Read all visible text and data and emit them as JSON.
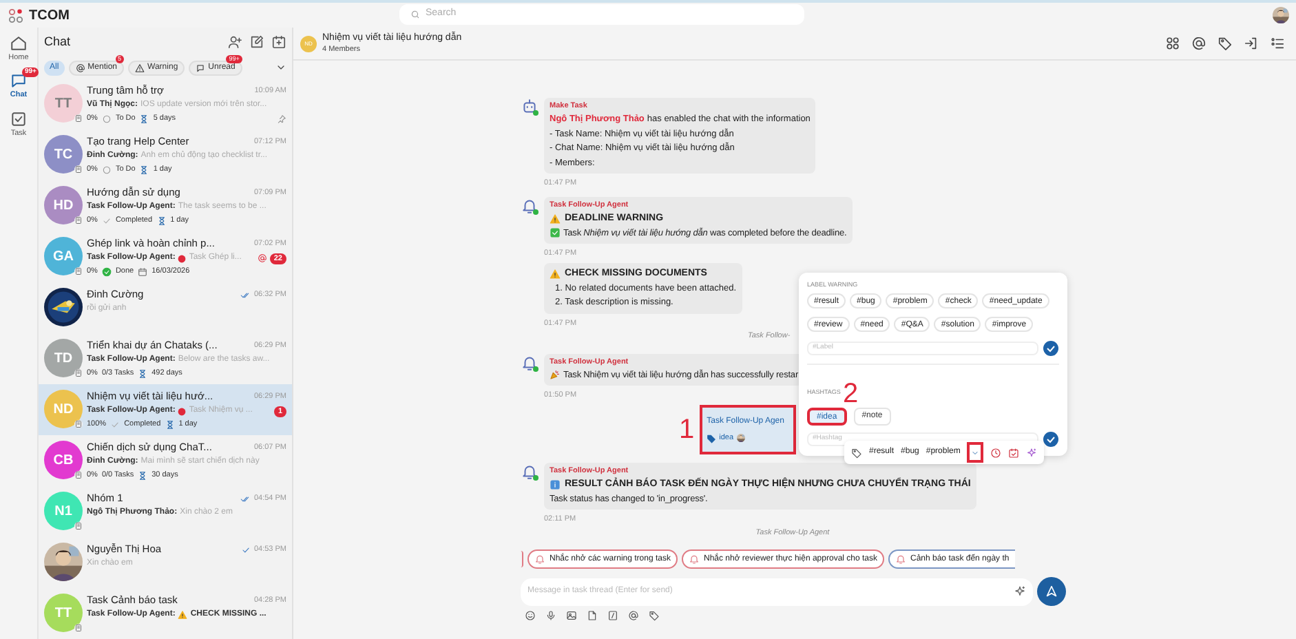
{
  "top_bar": {
    "app_name": "TCOM",
    "search_placeholder": "Search"
  },
  "nav": [
    {
      "label": "Home",
      "selected": false
    },
    {
      "label": "Chat",
      "selected": true,
      "badge": "99+"
    },
    {
      "label": "Task",
      "selected": false
    }
  ],
  "chat_list": {
    "title": "Chat",
    "filters": [
      {
        "label": "All",
        "selected": true
      },
      {
        "label": "Mention",
        "selected": false,
        "badge": "5"
      },
      {
        "label": "Warning",
        "selected": false
      },
      {
        "label": "Unread",
        "selected": false,
        "badge": "99+"
      }
    ],
    "conversations": [
      {
        "avatar": {
          "kind": "initials",
          "initials": "TT",
          "color": "#f3cfd6"
        },
        "name": "Trung tâm hỗ trợ",
        "time": "10:09 AM",
        "sender": "Vũ Thị Ngọc:",
        "preview": "IOS update version mới trên stor...",
        "progress": "0%",
        "status": {
          "kind": "todo",
          "text": "To Do"
        },
        "due": {
          "kind": "duration",
          "text": "5 days"
        },
        "pinned": true,
        "selected": false
      },
      {
        "avatar": {
          "kind": "initials",
          "initials": "TC",
          "color": "#8d8fc6"
        },
        "name": "Tạo trang Help Center",
        "time": "07:12 PM",
        "sender": "Đinh Cường:",
        "preview": "Anh em chủ động tạo checklist tr...",
        "progress": "0%",
        "status": {
          "kind": "todo",
          "text": "To Do"
        },
        "due": {
          "kind": "duration",
          "text": "1 day"
        },
        "selected": false
      },
      {
        "avatar": {
          "kind": "initials",
          "initials": "HD",
          "color": "#aa8cc2"
        },
        "name": "Hướng dẫn sử dụng",
        "time": "07:09 PM",
        "sender": "Task Follow-Up Agent:",
        "preview": "The task seems to be ...",
        "progress": "0%",
        "status": {
          "kind": "completed",
          "text": "Completed"
        },
        "due": {
          "kind": "duration",
          "text": "1 day"
        },
        "selected": false
      },
      {
        "avatar": {
          "kind": "initials",
          "initials": "GA",
          "color": "#4fb4d8"
        },
        "name": "Ghép link và hoàn chỉnh p...",
        "time": "07:02 PM",
        "sender": "Task Follow-Up Agent:",
        "alert": true,
        "preview": "Task Ghép li...",
        "mention": true,
        "unread": "22",
        "progress": "0%",
        "status": {
          "kind": "done",
          "text": "Done"
        },
        "due": {
          "kind": "date",
          "text": "16/03/2026"
        },
        "selected": false
      },
      {
        "name": "Đinh Cường",
        "time": "06:32 PM",
        "receipt": {
          "kind": "double"
        },
        "preview": "rồi gửi anh",
        "selected": false
      },
      {
        "avatar": {
          "kind": "initials",
          "initials": "TD",
          "color": "#a3a7a6"
        },
        "name": "Triển khai dự án Chataks (...",
        "time": "06:29 PM",
        "sender": "Task Follow-Up Agent:",
        "preview": "Below are the tasks aw...",
        "progress": "0%",
        "status": {
          "kind": "tasks",
          "text": "0/3 Tasks"
        },
        "due": {
          "kind": "duration",
          "text": "492 days"
        },
        "selected": false
      },
      {
        "avatar": {
          "kind": "initials",
          "initials": "ND",
          "color": "#ecc24e"
        },
        "name": "Nhiệm vụ viết tài liệu hướ...",
        "time": "06:29 PM",
        "sender": "Task Follow-Up Agent:",
        "alert": true,
        "preview": "Task Nhiệm vụ ...",
        "unread": "1",
        "progress": "100%",
        "status": {
          "kind": "completed",
          "text": "Completed"
        },
        "due": {
          "kind": "duration",
          "text": "1 day"
        },
        "selected": true
      },
      {
        "avatar": {
          "kind": "initials",
          "initials": "CB",
          "color": "#e23ad0"
        },
        "name": "Chiến dịch sử dụng ChaT...",
        "time": "06:07 PM",
        "sender": "Đinh Cường:",
        "preview": "Mai mình sẽ start chiến dịch này",
        "progress": "0%",
        "status": {
          "kind": "tasks",
          "text": "0/0 Tasks"
        },
        "due": {
          "kind": "duration",
          "text": "30 days"
        },
        "selected": false
      },
      {
        "avatar": {
          "kind": "initials",
          "initials": "N1",
          "color": "#3fe6b3"
        },
        "name": "Nhóm 1",
        "time": "04:54 PM",
        "receipt": {
          "kind": "double"
        },
        "sender": "Ngô Thị Phương Thảo:",
        "preview": "Xin chào 2 em",
        "selected": false
      },
      {
        "name": "Nguyễn Thị Hoa",
        "time": "04:53 PM",
        "receipt": {
          "kind": "single"
        },
        "preview": "Xin chào em",
        "selected": false
      },
      {
        "avatar": {
          "kind": "initials",
          "initials": "TT",
          "color": "#a6dc5c"
        },
        "name": "Task Cảnh báo task",
        "time": "04:28 PM",
        "sender": "Task Follow-Up Agent:",
        "preview_warning": true,
        "preview": "CHECK MISSING ...",
        "preview_bold": true,
        "selected": false
      }
    ]
  },
  "conversation": {
    "initials": "ND",
    "color": "#ecc24e",
    "title": "Nhiệm vụ viết tài liệu hướng dẫn",
    "subtitle": "4 Members"
  },
  "messages": [
    {
      "kind": "system",
      "sender": "Make Task",
      "actor": "Ngô Thị Phương Thảo",
      "text": "has enabled the chat with the information",
      "lines": [
        "- Task Name: Nhiệm vụ viết tài liệu hướng dẫn",
        "- Chat Name: Nhiệm vụ viết tài liệu hướng dẫn",
        "- Members:"
      ],
      "time": "01:47 PM"
    },
    {
      "kind": "agent",
      "sender": "Task Follow-Up Agent",
      "title": {
        "kind": "warning",
        "text": "DEADLINE WARNING"
      },
      "body": {
        "kind": "check",
        "text": "Task *Nhiệm vụ viết tài liệu hướng dẫn* was completed before the deadline."
      },
      "time": "01:47 PM"
    },
    {
      "kind": "agent_continued",
      "title": {
        "kind": "warning",
        "text": "CHECK MISSING DOCUMENTS"
      },
      "lines": [
        "1. No related documents have been attached.",
        "2. Task description is missing."
      ],
      "time": "01:47 PM"
    },
    {
      "kind": "note",
      "text": "Task Follow-"
    },
    {
      "kind": "agent",
      "sender": "Task Follow-Up Agent",
      "body": {
        "kind": "party",
        "text": "Task Nhiệm vụ viết tài liệu hướng dẫn has successfully restar"
      },
      "time": "01:50 PM"
    },
    {
      "kind": "reply_card",
      "title": "Task Follow-Up Agen",
      "tag": "idea",
      "annotation": "1"
    },
    {
      "kind": "agent",
      "sender": "Task Follow-Up Agent",
      "title": {
        "kind": "info",
        "text": "RESULT CẢNH BÁO TASK ĐẾN NGÀY THỰC HIỆN NHƯNG CHƯA CHUYỂN TRẠNG THÁI"
      },
      "body": {
        "kind": "plain",
        "text": "Task status has changed to 'in_progress'."
      },
      "time": "02:11 PM"
    },
    {
      "kind": "note",
      "text": "Task Follow-Up Agent"
    }
  ],
  "suggestions": [
    "Nhắc nhở các warning trong task",
    "Nhắc nhở reviewer thực hiện approval cho task",
    "Cảnh báo task đến ngày th"
  ],
  "composer": {
    "placeholder": "Message in task thread (Enter for send)"
  },
  "tag_popup": {
    "label_title": "LABEL WARNING",
    "labels": [
      "#result",
      "#bug",
      "#problem",
      "#check",
      "#need_update",
      "#review",
      "#need",
      "#Q&A",
      "#solution",
      "#improve"
    ],
    "label_placeholder": "#Label",
    "hashtag_title": "HASHTAGS",
    "hashtags": [
      {
        "text": "#idea",
        "selected": true,
        "annotation": "2"
      },
      {
        "text": "#note",
        "selected": false
      }
    ],
    "hashtag_placeholder": "#Hashtag"
  },
  "tag_toolbar": {
    "tags": [
      "#result",
      "#bug",
      "#problem"
    ],
    "expand_highlighted": true
  }
}
